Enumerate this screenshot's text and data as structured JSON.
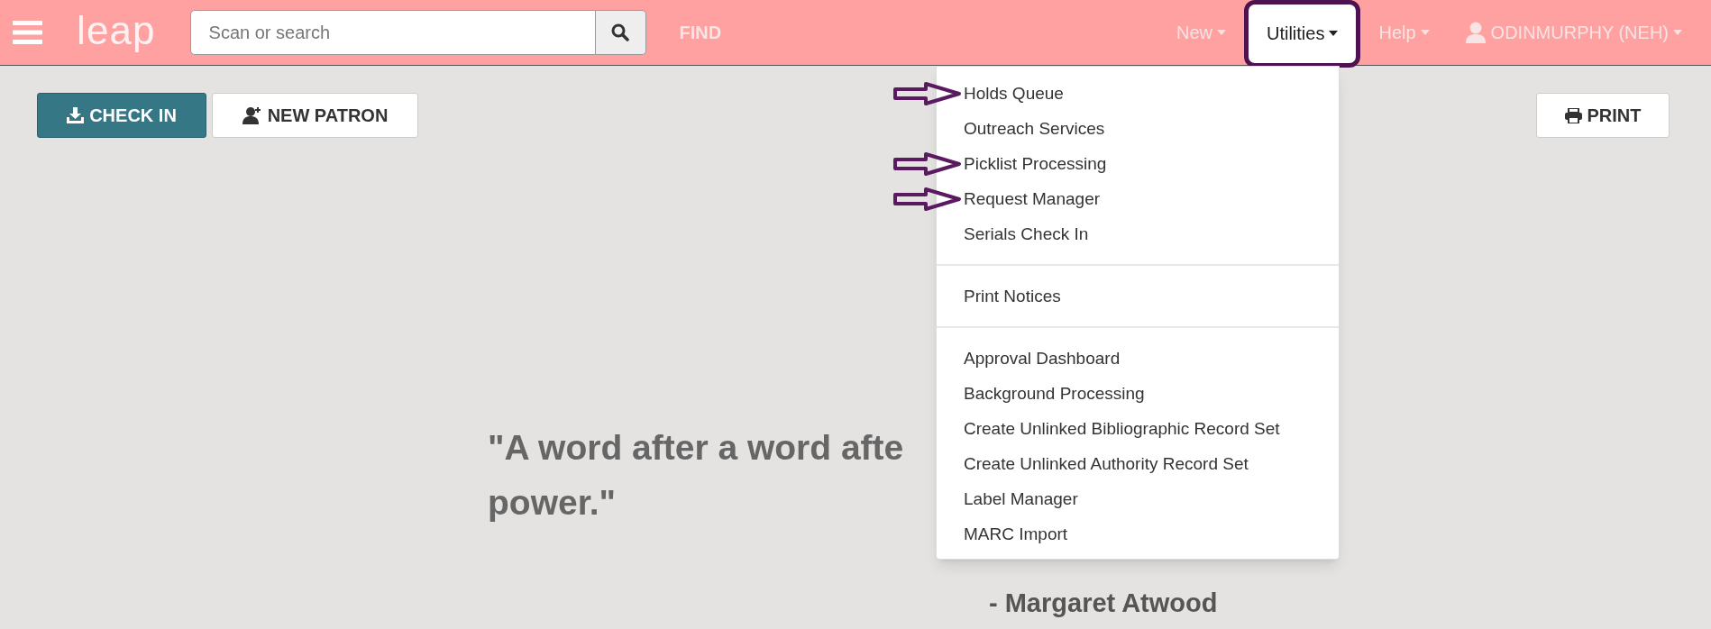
{
  "navbar": {
    "logo": "leap",
    "search": {
      "placeholder": "Scan or search"
    },
    "find": "FIND",
    "menus": [
      {
        "label": "New",
        "selected": false,
        "outlined": false,
        "kind": "menu"
      },
      {
        "label": "Utilities",
        "selected": true,
        "outlined": true,
        "kind": "menu"
      },
      {
        "label": "Help",
        "selected": false,
        "outlined": false,
        "kind": "menu"
      },
      {
        "label": "ODINMURPHY (NEH)",
        "selected": false,
        "outlined": false,
        "kind": "user"
      }
    ]
  },
  "toolbar": {
    "buttons": [
      {
        "label": "CHECK IN",
        "kind": "checkin"
      },
      {
        "label": "NEW PATRON",
        "kind": "patron"
      }
    ],
    "print": "PRINT"
  },
  "quote": {
    "lines": [
      "\"A word after a word afte",
      "power.\""
    ],
    "author": "- Margaret Atwood"
  },
  "utilities_menu": {
    "groups": [
      [
        {
          "label": "Holds Queue",
          "marked": true
        },
        {
          "label": "Outreach Services",
          "marked": false
        },
        {
          "label": "Picklist Processing",
          "marked": true
        },
        {
          "label": "Request Manager",
          "marked": true
        },
        {
          "label": "Serials Check In",
          "marked": false
        }
      ],
      [
        {
          "label": "Print Notices",
          "marked": false
        }
      ],
      [
        {
          "label": "Approval Dashboard",
          "marked": false
        },
        {
          "label": "Background Processing",
          "marked": false
        },
        {
          "label": "Create Unlinked Bibliographic Record Set",
          "marked": false
        },
        {
          "label": "Create Unlinked Authority Record Set",
          "marked": false
        },
        {
          "label": "Label Manager",
          "marked": false
        },
        {
          "label": "MARC Import",
          "marked": false
        }
      ]
    ]
  }
}
